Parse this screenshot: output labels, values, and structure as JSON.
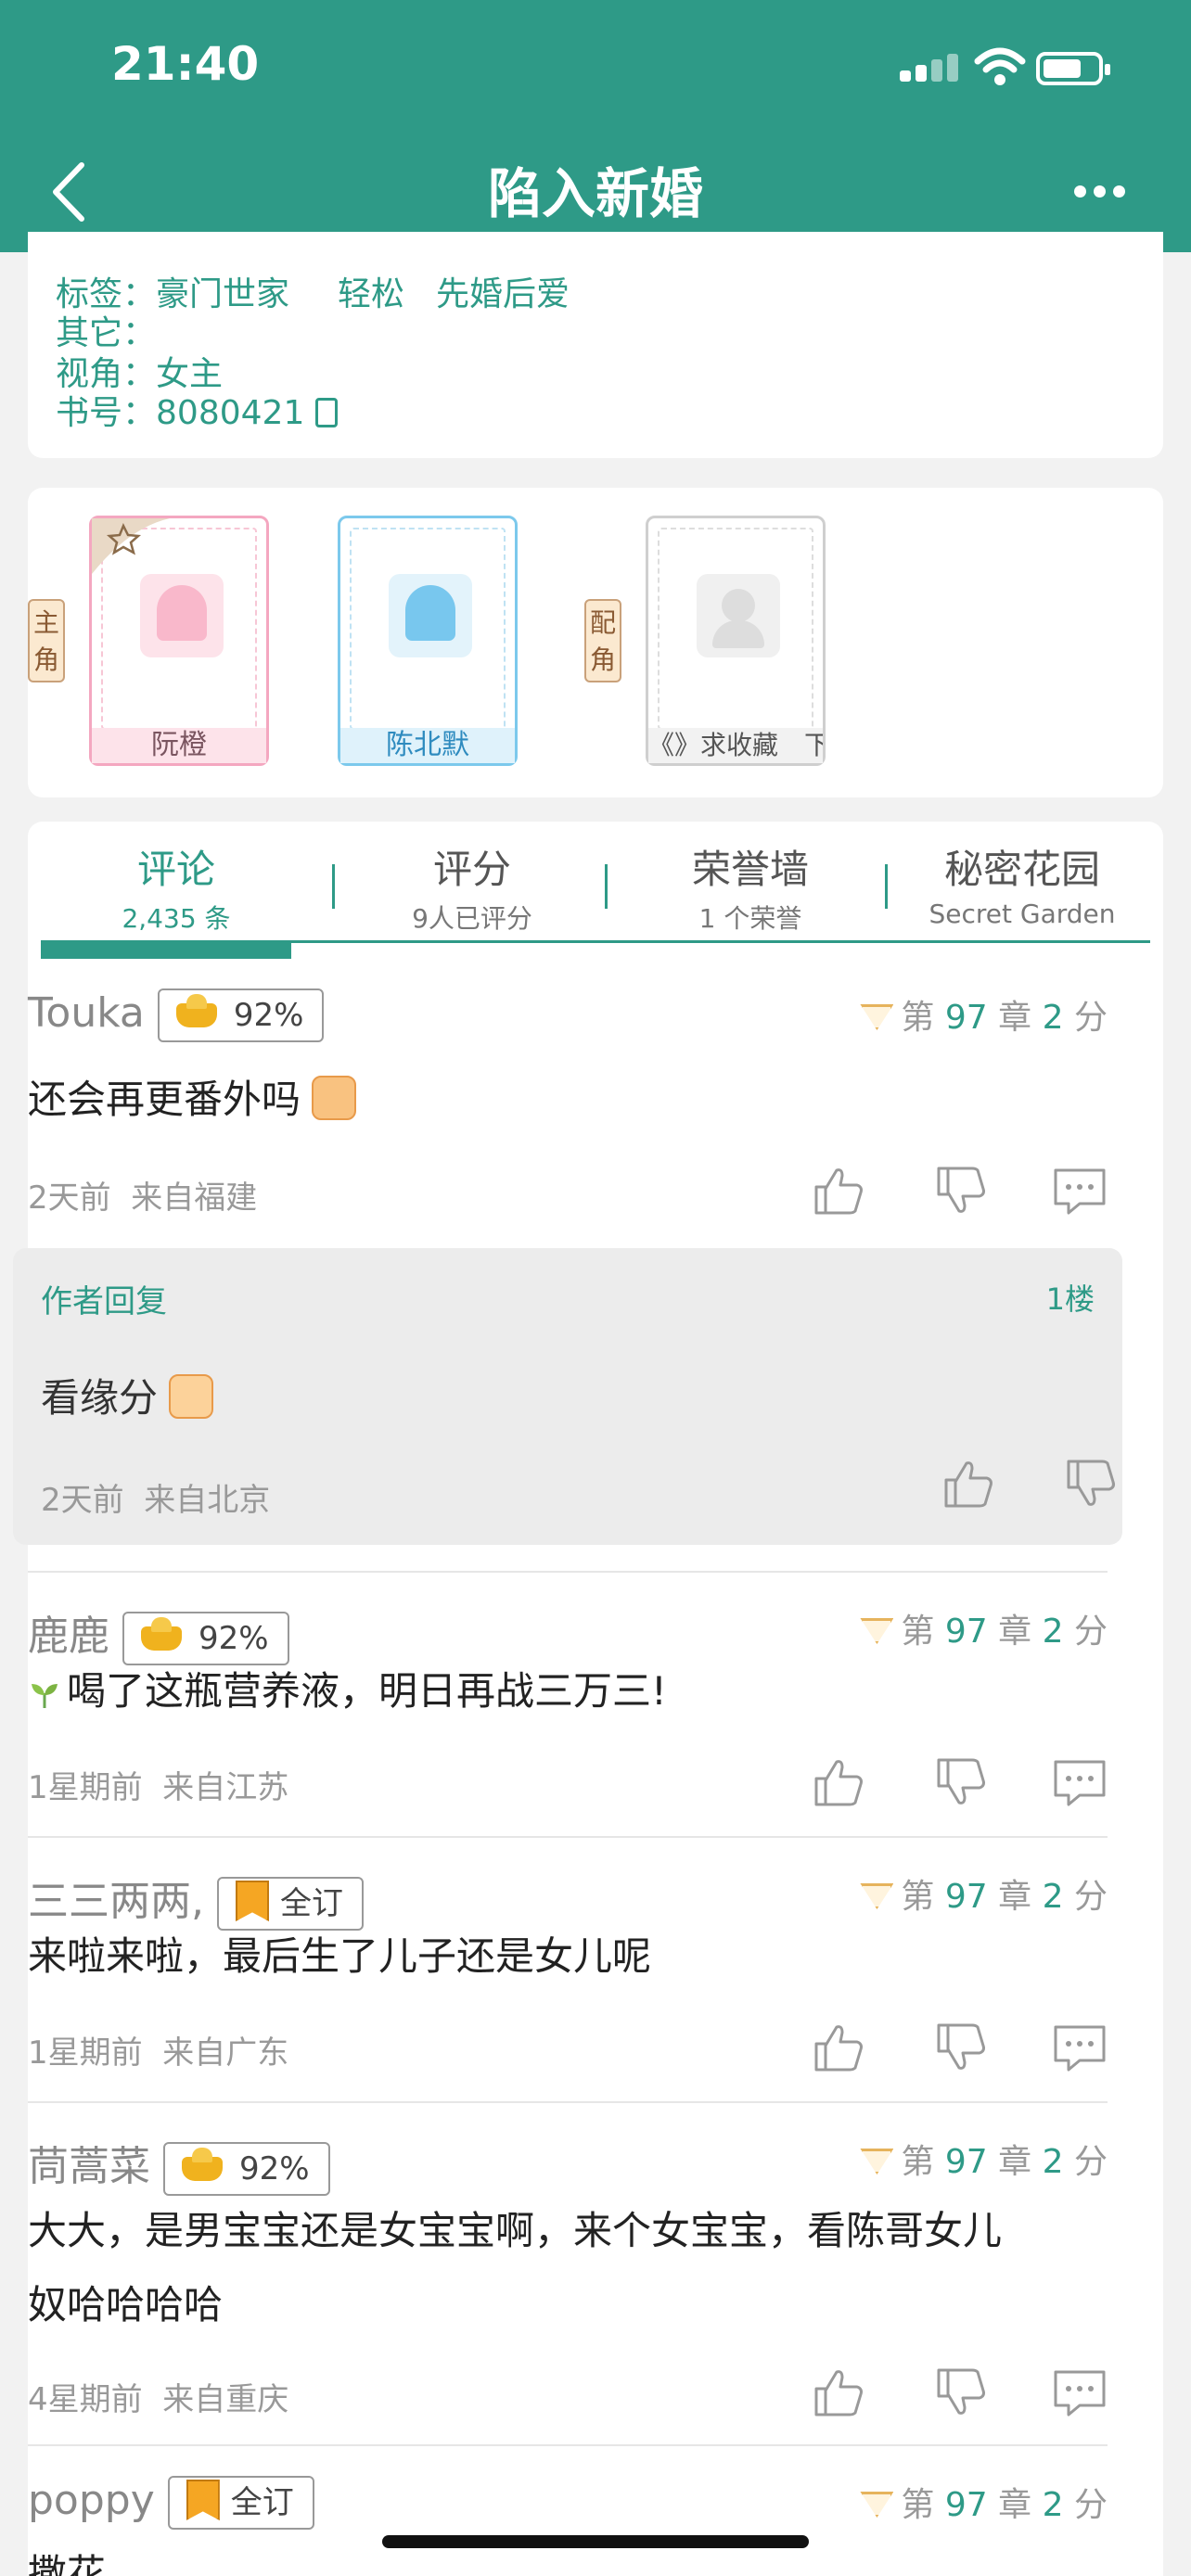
{
  "status_bar": {
    "time": "21:40"
  },
  "nav": {
    "title": "陷入新婚"
  },
  "info": {
    "tags_label": "标签：",
    "tags": [
      "豪门世家",
      "轻松",
      "先婚后爱"
    ],
    "other_label": "其它：",
    "view_label": "视角：",
    "view_value": "女主",
    "book_label": "书号：",
    "book_value": "8080421"
  },
  "roles": {
    "main_tag": "主角",
    "support_tag": "配角",
    "cards": [
      {
        "name": "阮橙"
      },
      {
        "name": "陈北默"
      },
      {
        "name": "《》求收藏　下"
      }
    ]
  },
  "tabs": [
    {
      "title": "评论",
      "sub": "2,435 条"
    },
    {
      "title": "评分",
      "sub": "9人已评分"
    },
    {
      "title": "荣誉墙",
      "sub": "1 个荣誉"
    },
    {
      "title": "秘密花园",
      "sub": "Secret Garden"
    }
  ],
  "comments": [
    {
      "user": "Touka",
      "badge": "92%",
      "chapter_prefix": "第",
      "chapter": "97",
      "chapter_mid": "章",
      "score": "2",
      "score_suffix": "分",
      "text": "还会再更番外吗",
      "time": "2天前",
      "location": "来自福建"
    },
    {
      "user": "鹿鹿",
      "badge": "92%",
      "chapter_prefix": "第",
      "chapter": "97",
      "chapter_mid": "章",
      "score": "2",
      "score_suffix": "分",
      "text": "喝了这瓶营养液，明日再战三万三!",
      "time": "1星期前",
      "location": "来自江苏"
    },
    {
      "user": "三三两两,",
      "badge": "全订",
      "chapter_prefix": "第",
      "chapter": "97",
      "chapter_mid": "章",
      "score": "2",
      "score_suffix": "分",
      "text": "来啦来啦，最后生了儿子还是女儿呢",
      "time": "1星期前",
      "location": "来自广东"
    },
    {
      "user": "茼蒿菜",
      "badge": "92%",
      "chapter_prefix": "第",
      "chapter": "97",
      "chapter_mid": "章",
      "score": "2",
      "score_suffix": "分",
      "text_line1": "大大，是男宝宝还是女宝宝啊，来个女宝宝，看陈哥女儿",
      "text_line2": "奴哈哈哈哈",
      "time": "4星期前",
      "location": "来自重庆"
    },
    {
      "user": "poppy",
      "badge": "全订",
      "chapter_prefix": "第",
      "chapter": "97",
      "chapter_mid": "章",
      "score": "2",
      "score_suffix": "分",
      "text": "撒花"
    }
  ],
  "author_reply": {
    "label": "作者回复",
    "floor": "1楼",
    "text": "看缘分",
    "time": "2天前",
    "location": "来自北京"
  }
}
